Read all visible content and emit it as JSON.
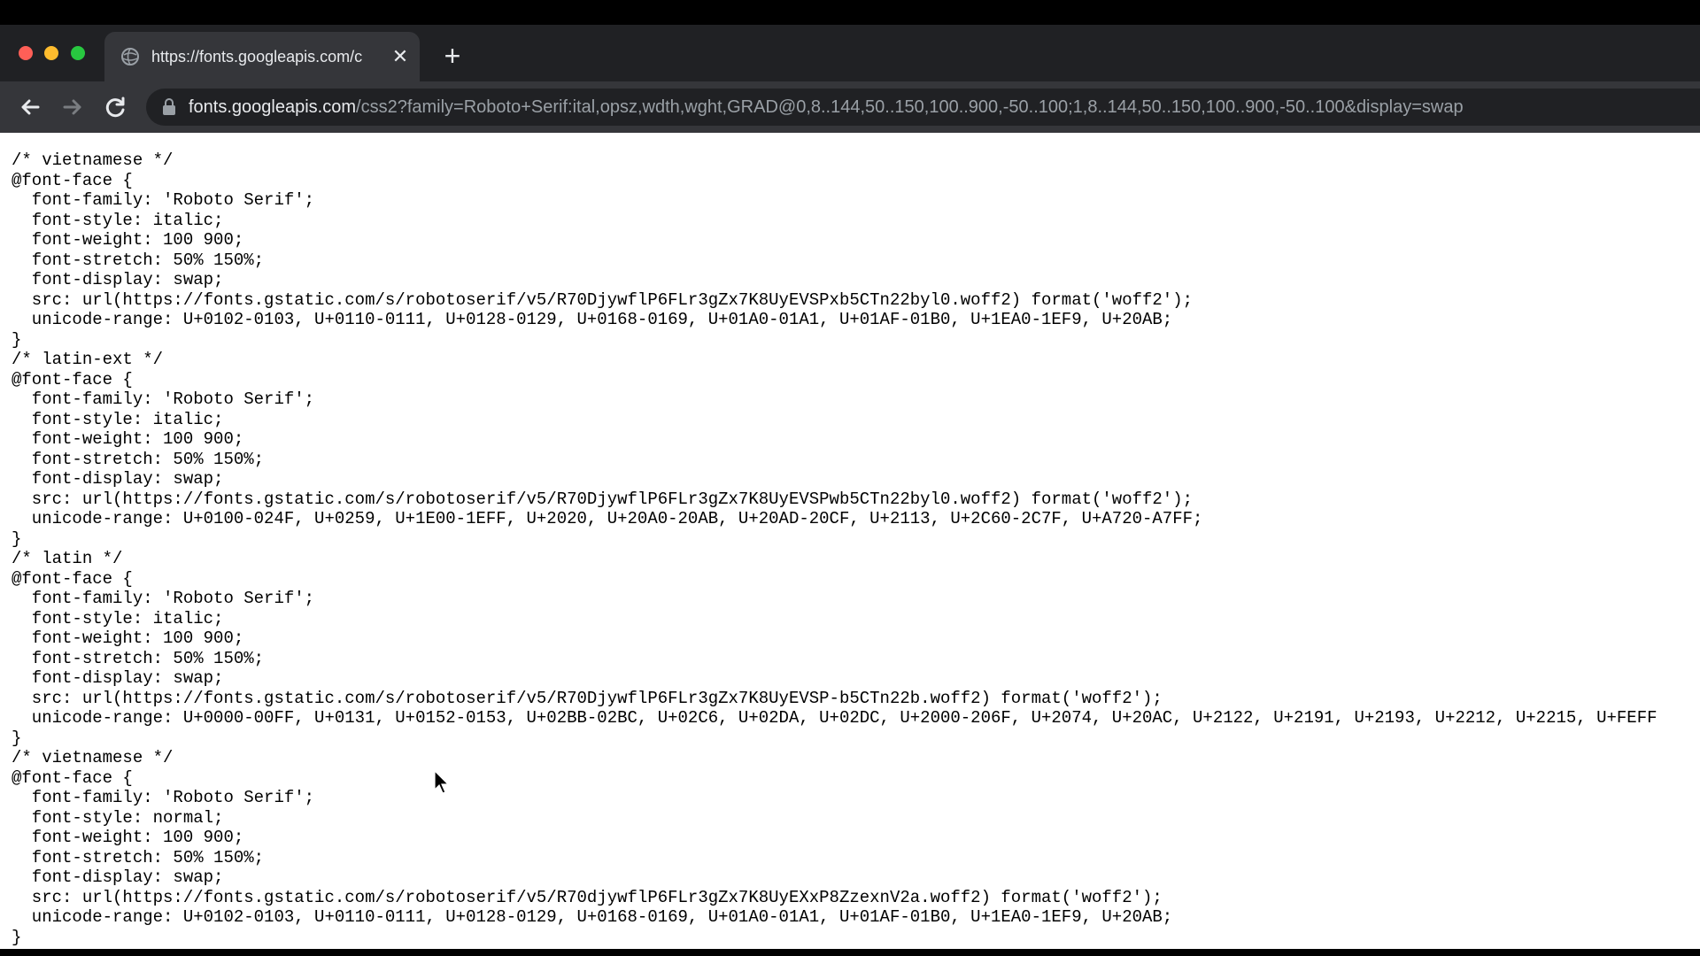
{
  "browser": {
    "tab": {
      "title": "https://fonts.googleapis.com/c",
      "close_icon": "close-icon",
      "favicon": "globe-icon"
    },
    "new_tab_icon": "plus-icon",
    "toolbar": {
      "back_icon": "arrow-left-icon",
      "forward_icon": "arrow-right-icon",
      "reload_icon": "reload-icon",
      "lock_icon": "lock-icon"
    },
    "url": {
      "domain": "fonts.googleapis.com",
      "path": "/css2?family=Roboto+Serif:ital,opsz,wdth,wght,GRAD@0,8..144,50..150,100..900,-50..100;1,8..144,50..150,100..900,-50..100&display=swap"
    }
  },
  "page": {
    "lines": [
      "/* vietnamese */",
      "@font-face {",
      "  font-family: 'Roboto Serif';",
      "  font-style: italic;",
      "  font-weight: 100 900;",
      "  font-stretch: 50% 150%;",
      "  font-display: swap;",
      "  src: url(https://fonts.gstatic.com/s/robotoserif/v5/R70DjywflP6FLr3gZx7K8UyEVSPxb5CTn22byl0.woff2) format('woff2');",
      "  unicode-range: U+0102-0103, U+0110-0111, U+0128-0129, U+0168-0169, U+01A0-01A1, U+01AF-01B0, U+1EA0-1EF9, U+20AB;",
      "}",
      "/* latin-ext */",
      "@font-face {",
      "  font-family: 'Roboto Serif';",
      "  font-style: italic;",
      "  font-weight: 100 900;",
      "  font-stretch: 50% 150%;",
      "  font-display: swap;",
      "  src: url(https://fonts.gstatic.com/s/robotoserif/v5/R70DjywflP6FLr3gZx7K8UyEVSPwb5CTn22byl0.woff2) format('woff2');",
      "  unicode-range: U+0100-024F, U+0259, U+1E00-1EFF, U+2020, U+20A0-20AB, U+20AD-20CF, U+2113, U+2C60-2C7F, U+A720-A7FF;",
      "}",
      "/* latin */",
      "@font-face {",
      "  font-family: 'Roboto Serif';",
      "  font-style: italic;",
      "  font-weight: 100 900;",
      "  font-stretch: 50% 150%;",
      "  font-display: swap;",
      "  src: url(https://fonts.gstatic.com/s/robotoserif/v5/R70DjywflP6FLr3gZx7K8UyEVSP-b5CTn22b.woff2) format('woff2');",
      "  unicode-range: U+0000-00FF, U+0131, U+0152-0153, U+02BB-02BC, U+02C6, U+02DA, U+02DC, U+2000-206F, U+2074, U+20AC, U+2122, U+2191, U+2193, U+2212, U+2215, U+FEFF",
      "}",
      "/* vietnamese */",
      "@font-face {",
      "  font-family: 'Roboto Serif';",
      "  font-style: normal;",
      "  font-weight: 100 900;",
      "  font-stretch: 50% 150%;",
      "  font-display: swap;",
      "  src: url(https://fonts.gstatic.com/s/robotoserif/v5/R70djywflP6FLr3gZx7K8UyEXxP8ZzexnV2a.woff2) format('woff2');",
      "  unicode-range: U+0102-0103, U+0110-0111, U+0128-0129, U+0168-0169, U+01A0-01A1, U+01AF-01B0, U+1EA0-1EF9, U+20AB;",
      "}"
    ]
  },
  "colors": {
    "tabstrip": "#202124",
    "toolbar": "#35363a",
    "text_light": "#e8eaed",
    "text_dim": "#9aa0a6",
    "traffic_close": "#ff5f57",
    "traffic_min": "#febc2e",
    "traffic_max": "#28c840"
  }
}
